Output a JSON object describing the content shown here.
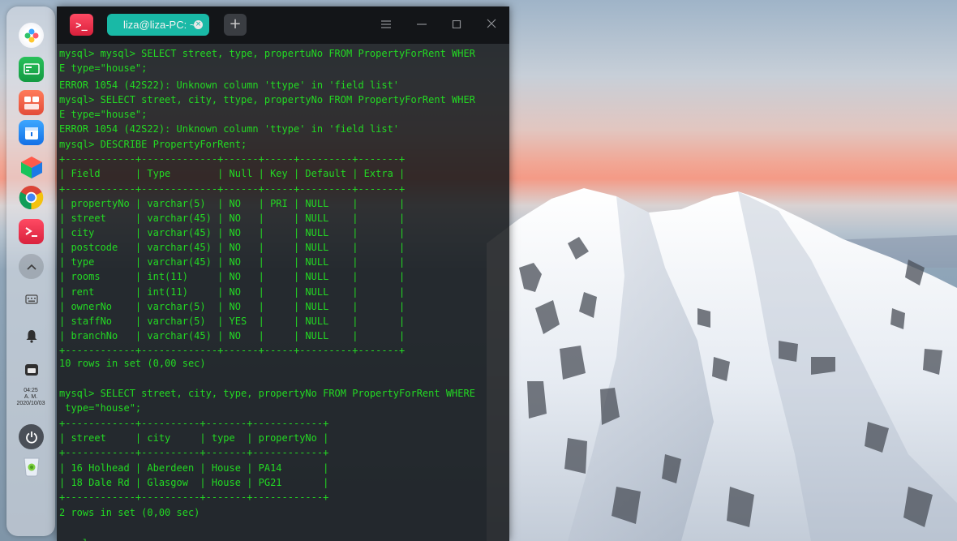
{
  "terminal": {
    "tab_title": "liza@liza-PC: ~",
    "new_tab_label": "+",
    "lines": [
      "mysql> mysql> SELECT street, type, propertuNo FROM PropertyForRent WHER",
      "E type=\"house\";",
      "ERROR 1054 (42S22): Unknown column 'ttype' in 'field list'",
      "mysql> SELECT street, city, ttype, propertyNo FROM PropertyForRent WHER",
      "E type=\"house\";",
      "ERROR 1054 (42S22): Unknown column 'ttype' in 'field list'",
      "mysql> DESCRIBE PropertyForRent;",
      "+------------+-------------+------+-----+---------+-------+",
      "| Field      | Type        | Null | Key | Default | Extra |",
      "+------------+-------------+------+-----+---------+-------+",
      "| propertyNo | varchar(5)  | NO   | PRI | NULL    |       |",
      "| street     | varchar(45) | NO   |     | NULL    |       |",
      "| city       | varchar(45) | NO   |     | NULL    |       |",
      "| postcode   | varchar(45) | NO   |     | NULL    |       |",
      "| type       | varchar(45) | NO   |     | NULL    |       |",
      "| rooms      | int(11)     | NO   |     | NULL    |       |",
      "| rent       | int(11)     | NO   |     | NULL    |       |",
      "| ownerNo    | varchar(5)  | NO   |     | NULL    |       |",
      "| staffNo    | varchar(5)  | YES  |     | NULL    |       |",
      "| branchNo   | varchar(45) | NO   |     | NULL    |       |",
      "+------------+-------------+------+-----+---------+-------+",
      "10 rows in set (0,00 sec)",
      "",
      "mysql> SELECT street, city, type, propertyNo FROM PropertyForRent WHERE",
      " type=\"house\";",
      "+------------+----------+-------+------------+",
      "| street     | city     | type  | propertyNo |",
      "+------------+----------+-------+------------+",
      "| 16 Holhead | Aberdeen | House | PA14       |",
      "| 18 Dale Rd | Glasgow  | House | PG21       |",
      "+------------+----------+-------+------------+",
      "2 rows in set (0,00 sec)",
      "",
      "mysql> "
    ]
  },
  "dock": {
    "clock_time": "04:25",
    "clock_ampm": "A. M.",
    "clock_date": "2020/10/03"
  },
  "colors": {
    "terminal_text": "#23d923",
    "tab_accent": "#19b9a6",
    "terminal_icon": "#e8304b"
  },
  "icons": {
    "launcher": "launcher-icon",
    "monitor": "system-monitor-icon",
    "app_store": "app-store-icon",
    "cleaner": "device-manager-icon",
    "cube": "cube-app-icon",
    "chrome": "chrome-icon",
    "terminal": "terminal-icon",
    "up": "chevron-up-icon",
    "keyboard": "keyboard-icon",
    "bell": "bell-icon",
    "window": "window-icon",
    "power": "power-icon",
    "trash": "trash-icon"
  }
}
